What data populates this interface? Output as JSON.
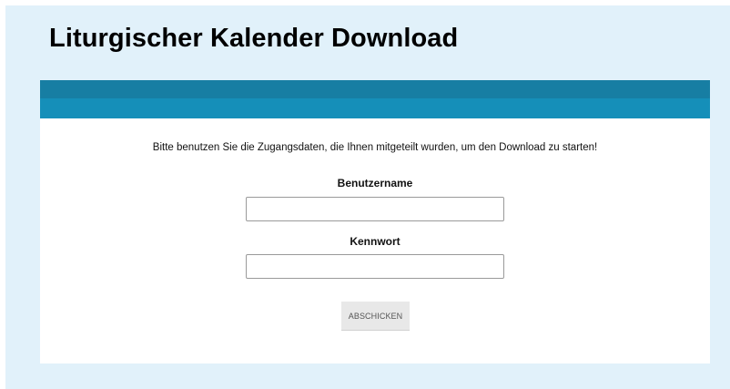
{
  "page": {
    "title": "Liturgischer Kalender Download"
  },
  "form": {
    "intro": "Bitte benutzen Sie die Zugangsdaten, die Ihnen mitgeteilt wurden, um den Download zu starten!",
    "username_label": "Benutzername",
    "username_value": "",
    "password_label": "Kennwort",
    "password_value": "",
    "submit_label": "ABSCHICKEN"
  },
  "colors": {
    "page_background": "#e1f1fa",
    "header_bar_top": "#177ea3",
    "header_bar_bottom": "#158fb9",
    "panel_background": "#ffffff",
    "button_background": "#e8e8e8"
  }
}
